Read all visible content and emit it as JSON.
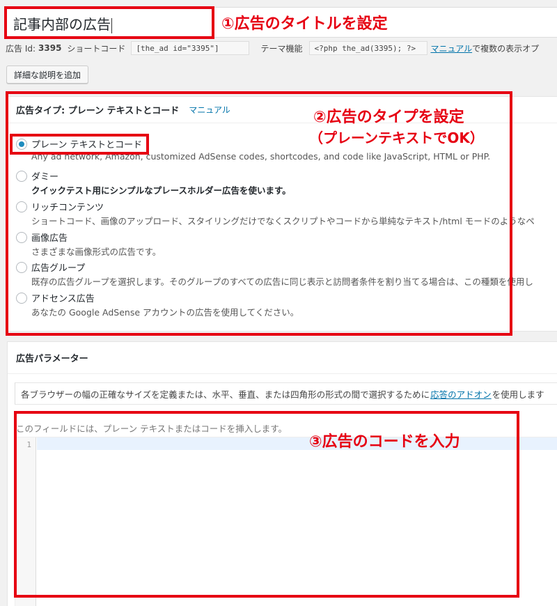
{
  "title_field": {
    "value": "記事内部の広告"
  },
  "meta": {
    "ad_id_label": "広告 Id:",
    "ad_id": "3395",
    "shortcode_label": "ショートコード",
    "shortcode_value": "[the_ad id=\"3395\"]",
    "theme_label": "テーマ機能",
    "theme_value": "<?php the_ad(3395); ?>",
    "manual_link": "マニュアル",
    "manual_suffix": "で複数の表示オプ"
  },
  "add_description_button": "詳細な説明を追加",
  "ad_type_panel": {
    "title": "広告タイプ: プレーン テキストとコード",
    "manual_link": "マニュアル",
    "options": [
      {
        "name": "プレーン テキストとコード",
        "desc": "Any ad network, Amazon, customized AdSense codes, shortcodes, and code like JavaScript, HTML or PHP.",
        "checked": true
      },
      {
        "name": "ダミー",
        "desc": "クイックテスト用にシンプルなプレースホルダー広告を使います。",
        "checked": false
      },
      {
        "name": "リッチコンテンツ",
        "desc": "ショートコード、画像のアップロード、スタイリングだけでなくスクリプトやコードから単純なテキスト/html モードのようなペ",
        "checked": false
      },
      {
        "name": "画像広告",
        "desc": "さまざまな画像形式の広告です。",
        "checked": false
      },
      {
        "name": "広告グループ",
        "desc": "既存の広告グループを選択します。そのグループのすべての広告に同じ表示と訪問者条件を割り当てる場合は、この種類を使用し",
        "checked": false
      },
      {
        "name": "アドセンス広告",
        "desc": "あなたの Google AdSense アカウントの広告を使用してください。",
        "checked": false
      }
    ]
  },
  "params_panel": {
    "title": "広告パラメーター",
    "notice_before": "各ブラウザーの幅の正確なサイズを定義または、水平、垂直、または四角形の形式の間で選択するために",
    "notice_link": "応答のアドオン",
    "notice_after": "を使用します",
    "field_help": "このフィールドには、プレーン テキストまたはコードを挿入します。",
    "line_number": "1"
  },
  "annotations": {
    "step1": "①広告のタイトルを設定",
    "step2_line1": "②広告のタイプを設定",
    "step2_line2": "（プレーンテキストでOK）",
    "step3": "③広告のコードを入力",
    "color": "#e60012"
  }
}
